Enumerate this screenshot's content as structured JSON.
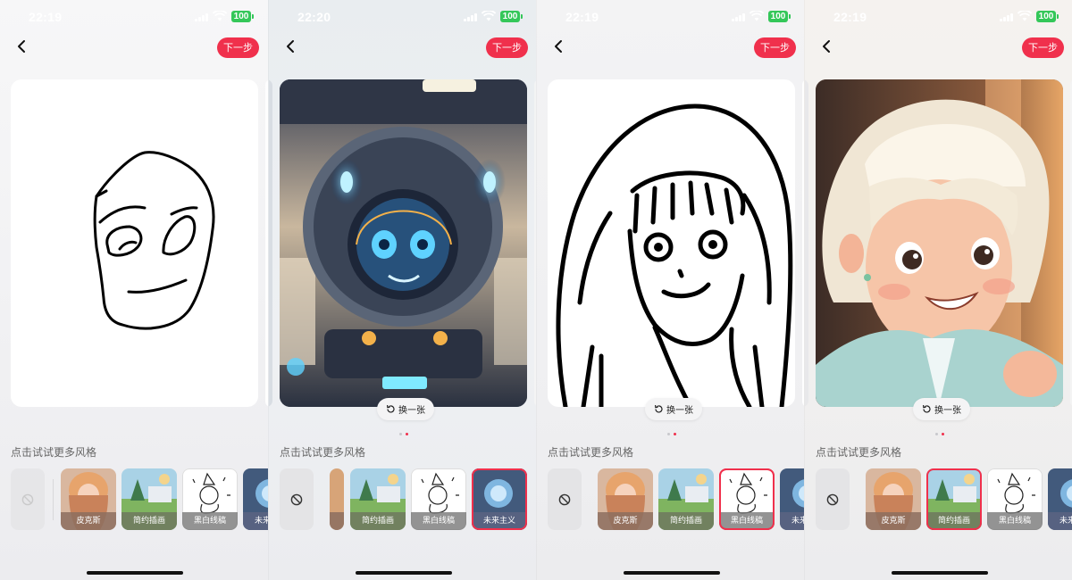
{
  "common": {
    "next_label": "下一步",
    "swap_label": "换一张",
    "style_section_title": "点击试试更多风格",
    "battery": "100",
    "colors": {
      "accent": "#f0304c",
      "battery": "#34c759"
    }
  },
  "screens": [
    {
      "time": "22:19",
      "image": "hand-drawn face sketch",
      "show_swap": false,
      "styles": [
        "皮克斯",
        "简约插画",
        "黑白线稿",
        "未来主义"
      ],
      "selected_style": null
    },
    {
      "time": "22:20",
      "image": "futuristic robot",
      "show_swap": true,
      "styles": [
        "简约插画",
        "黑白线稿",
        "未来主义"
      ],
      "selected_style": "未来主义"
    },
    {
      "time": "22:19",
      "image": "black-and-white line art girl",
      "show_swap": true,
      "styles": [
        "皮克斯",
        "简约插画",
        "黑白线稿",
        "未来主义"
      ],
      "selected_style": "黑白线稿"
    },
    {
      "time": "22:19",
      "image": "illustrated girl",
      "show_swap": true,
      "styles": [
        "皮克斯",
        "简约插画",
        "黑白线稿",
        "未来主义"
      ],
      "selected_style": "简约插画"
    }
  ],
  "icons": [
    "back-arrow-icon",
    "refresh-icon",
    "no-style-icon",
    "signal-icon",
    "wifi-icon",
    "battery-icon"
  ]
}
